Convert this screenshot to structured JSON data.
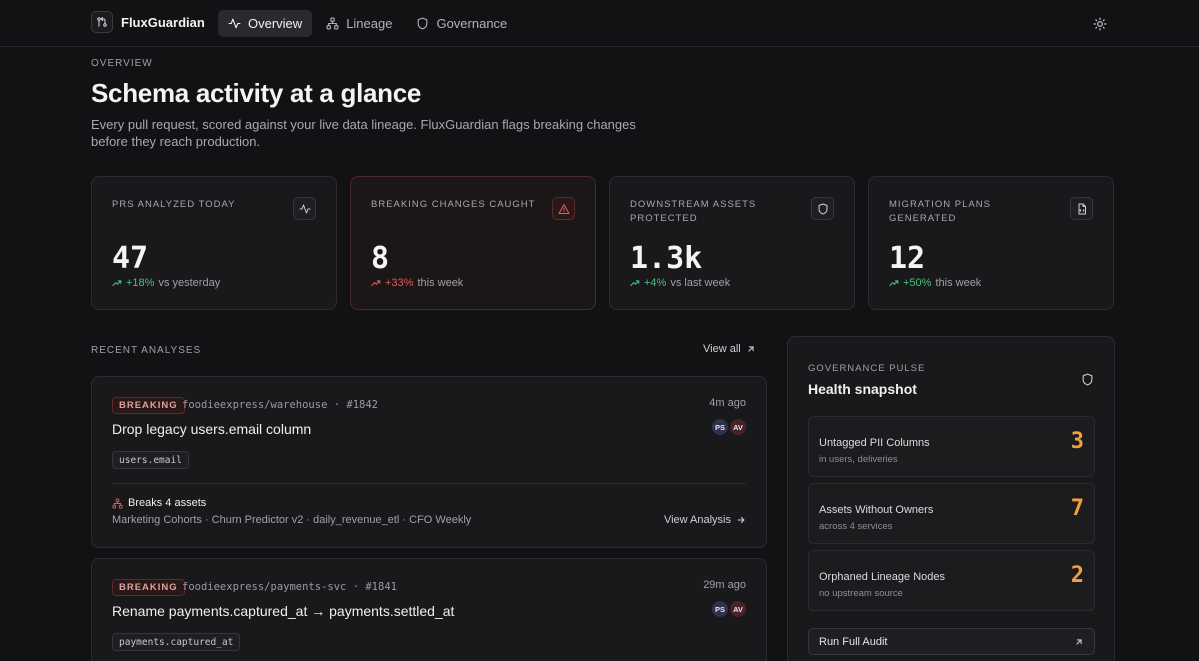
{
  "app": {
    "name": "FluxGuardian",
    "nav": [
      {
        "label": "Overview",
        "icon": "activity-icon",
        "active": true
      },
      {
        "label": "Lineage",
        "icon": "network-icon",
        "active": false
      },
      {
        "label": "Governance",
        "icon": "shield-icon",
        "active": false
      }
    ]
  },
  "hero": {
    "eyebrow": "OVERVIEW",
    "title": "Schema activity at a glance",
    "subtitle": "Every pull request, scored against your live data lineage. FluxGuardian flags breaking changes before they reach production."
  },
  "stats": [
    {
      "label": "PRS ANALYZED TODAY",
      "value": "47",
      "delta": "+18%",
      "context": "vs yesterday",
      "trend": "positive",
      "icon": "activity-icon"
    },
    {
      "label": "BREAKING CHANGES CAUGHT",
      "value": "8",
      "delta": "+33%",
      "context": "this week",
      "trend": "negative",
      "icon": "alert-triangle-icon"
    },
    {
      "label": "DOWNSTREAM ASSETS PROTECTED",
      "value": "1.3k",
      "delta": "+4%",
      "context": "vs last week",
      "trend": "positive",
      "icon": "shield-icon"
    },
    {
      "label": "MIGRATION PLANS GENERATED",
      "value": "12",
      "delta": "+50%",
      "context": "this week",
      "trend": "positive",
      "icon": "file-code-icon"
    }
  ],
  "recent": {
    "label": "RECENT ANALYSES",
    "view_all": "View all",
    "items": [
      {
        "badge": "BREAKING",
        "repo": "foodieexpress/warehouse",
        "sep": "·",
        "pr": "#1842",
        "ago": "4m ago",
        "title": "Drop legacy users.email column",
        "avatars": [
          "PS",
          "AV"
        ],
        "field": "users.email",
        "breaks": "Breaks 4 assets",
        "assets": "Marketing Cohorts · Churn Predictor v2 · daily_revenue_etl · CFO Weekly",
        "action": "View Analysis"
      },
      {
        "badge": "BREAKING",
        "repo": "foodieexpress/payments-svc",
        "sep": "·",
        "pr": "#1841",
        "ago": "29m ago",
        "title": "Rename payments.captured_at → payments.settled_at",
        "avatars": [
          "PS",
          "AV"
        ],
        "field": "payments.captured_at"
      }
    ]
  },
  "governance": {
    "eyebrow": "GOVERNANCE PULSE",
    "title": "Health snapshot",
    "metrics": [
      {
        "name": "Untagged PII Columns",
        "sub": "in users, deliveries",
        "value": "3"
      },
      {
        "name": "Assets Without Owners",
        "sub": "across 4 services",
        "value": "7"
      },
      {
        "name": "Orphaned Lineage Nodes",
        "sub": "no upstream source",
        "value": "2"
      }
    ],
    "audit_label": "Run Full Audit"
  },
  "colors": {
    "accent_warning": "#f0a040",
    "positive": "#4cc07a",
    "negative": "#e25c5c"
  }
}
